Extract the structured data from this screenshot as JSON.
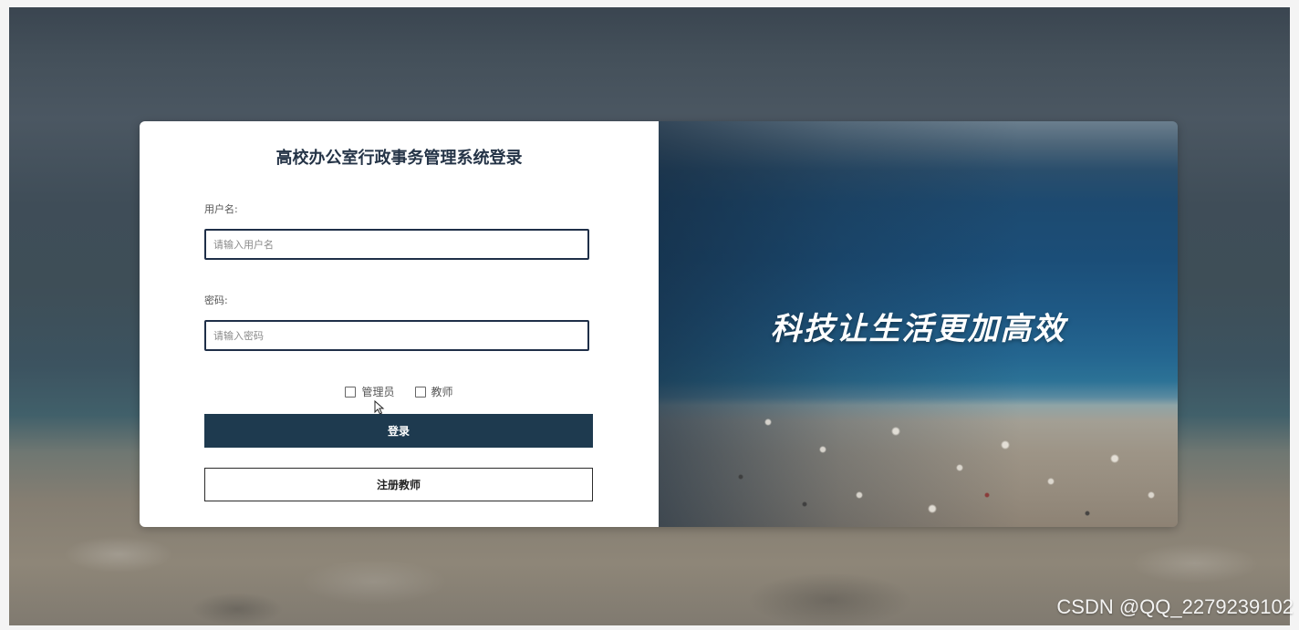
{
  "login": {
    "title": "高校办公室行政事务管理系统登录",
    "username_label": "用户名:",
    "username_placeholder": "请输入用户名",
    "password_label": "密码:",
    "password_placeholder": "请输入密码",
    "roles": [
      {
        "label": "管理员",
        "checked": false
      },
      {
        "label": "教师",
        "checked": false
      }
    ],
    "login_button": "登录",
    "register_button": "注册教师"
  },
  "banner": {
    "slogan": "科技让生活更加高效"
  },
  "watermark": "CSDN @QQ_2279239102",
  "colors": {
    "primary": "#1e3a4f",
    "title": "#253447",
    "input_border": "#1f2f48"
  }
}
